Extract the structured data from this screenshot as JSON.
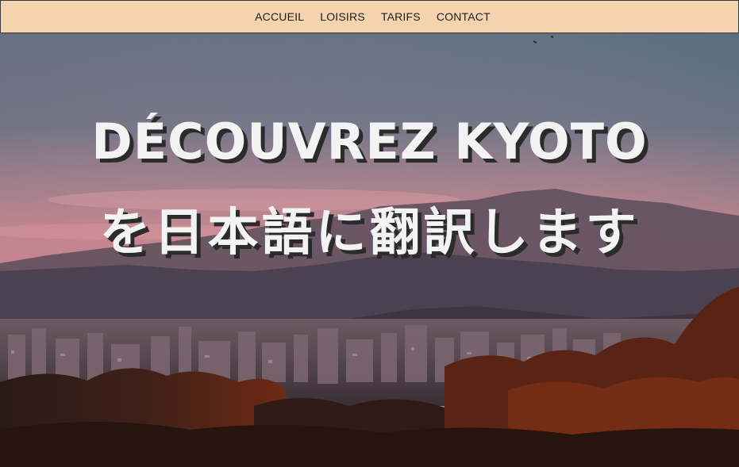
{
  "navbar": {
    "links": [
      {
        "label": "ACCUEIL"
      },
      {
        "label": "LOISIRS"
      },
      {
        "label": "TARIFS"
      },
      {
        "label": "CONTACT"
      }
    ],
    "background_color": "#f4d4ae"
  },
  "hero": {
    "title": "DÉCOUVREZ KYOTO",
    "subtitle": "を日本語に翻訳します",
    "text_color": "#f3f3f3",
    "shadow_color": "#2b2b2b"
  }
}
